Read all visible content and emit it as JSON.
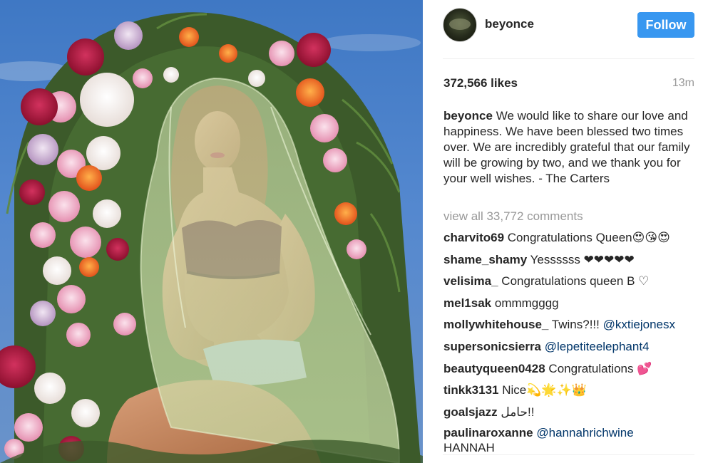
{
  "post": {
    "username": "beyonce",
    "follow_label": "Follow",
    "likes": "372,566 likes",
    "time": "13m",
    "caption_user": "beyonce",
    "caption_text": "We would like to share our love and happiness. We have been blessed two times over. We are incredibly grateful that our family will be growing by two, and we thank you for your well wishes. - The Carters",
    "view_all": "view all 33,772 comments"
  },
  "comments": [
    {
      "user": "charvito69",
      "text": "Congratulations Queen😍😘😍",
      "mention": ""
    },
    {
      "user": "shame_shamy",
      "text": "Yessssss ❤❤❤❤❤",
      "mention": ""
    },
    {
      "user": "velisima_",
      "text": "Congratulations queen B ♡",
      "mention": ""
    },
    {
      "user": "mel1sak",
      "text": "ommmgggg",
      "mention": ""
    },
    {
      "user": "mollywhitehouse_",
      "text": "Twins?!!!",
      "mention": "@kxtiejonesx"
    },
    {
      "user": "supersonicsierra",
      "text": "",
      "mention": "@lepetiteelephant4"
    },
    {
      "user": "beautyqueen0428",
      "text": "Congratulations 💕",
      "mention": ""
    },
    {
      "user": "tinkk3131",
      "text": "Nice💫🌟✨👑",
      "mention": ""
    },
    {
      "user": "goalsjazz",
      "text": "حامل!!",
      "mention": ""
    },
    {
      "user": "paulinaroxanne",
      "text": "",
      "mention": "@hannahrichwine",
      "extra": "HANNAH"
    }
  ],
  "colors": {
    "follow": "#3897f0",
    "muted": "#999999",
    "mention": "#003569",
    "text": "#262626",
    "sky": "#4a7fc8"
  },
  "icons": {
    "avatar": "profile-avatar"
  }
}
